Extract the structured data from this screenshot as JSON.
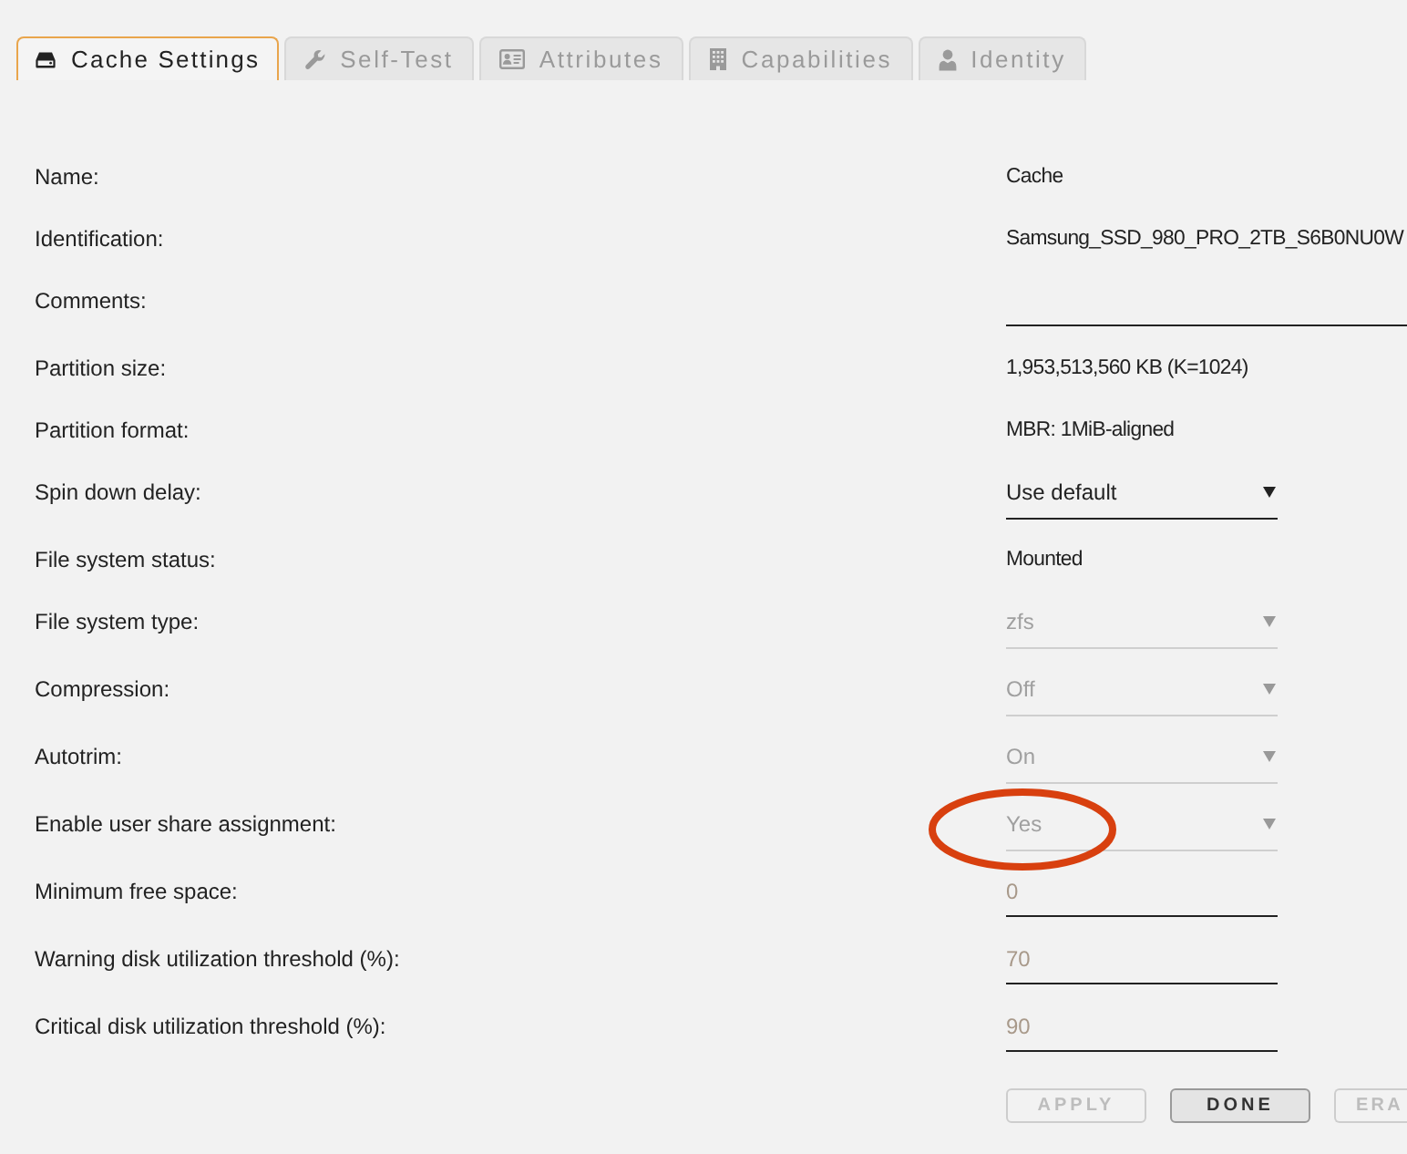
{
  "tabs": [
    {
      "label": "Cache Settings",
      "selected": true
    },
    {
      "label": "Self-Test",
      "selected": false
    },
    {
      "label": "Attributes",
      "selected": false
    },
    {
      "label": "Capabilities",
      "selected": false
    },
    {
      "label": "Identity",
      "selected": false
    }
  ],
  "form": {
    "rows": [
      {
        "label": "Name:",
        "kind": "text",
        "value": "Cache",
        "disabled": false,
        "circled": false
      },
      {
        "label": "Identification:",
        "kind": "text",
        "value": "Samsung_SSD_980_PRO_2TB_S6B0NU0W",
        "disabled": false,
        "circled": false
      },
      {
        "label": "Comments:",
        "kind": "text_input",
        "disabled": false,
        "circled": false
      },
      {
        "label": "Partition size:",
        "kind": "text",
        "value": "1,953,513,560 KB (K=1024)",
        "disabled": false,
        "circled": false
      },
      {
        "label": "Partition format:",
        "kind": "text",
        "value": "MBR: 1MiB-aligned",
        "disabled": false,
        "circled": false
      },
      {
        "label": "Spin down delay:",
        "kind": "select",
        "value": "Use default",
        "disabled": false,
        "circled": false
      },
      {
        "label": "File system status:",
        "kind": "text",
        "value": "Mounted",
        "disabled": false,
        "circled": false
      },
      {
        "label": "File system type:",
        "kind": "select",
        "value": "zfs",
        "disabled": true,
        "circled": false
      },
      {
        "label": "Compression:",
        "kind": "select",
        "value": "Off",
        "disabled": true,
        "circled": false
      },
      {
        "label": "Autotrim:",
        "kind": "select",
        "value": "On",
        "disabled": true,
        "circled": false
      },
      {
        "label": "Enable user share assignment:",
        "kind": "select",
        "value": "Yes",
        "disabled": true,
        "circled": true
      },
      {
        "label": "Minimum free space:",
        "kind": "number_input",
        "placeholder": "0",
        "disabled": false,
        "circled": false
      },
      {
        "label": "Warning disk utilization threshold (%):",
        "kind": "number_input",
        "placeholder": "70",
        "disabled": false,
        "circled": false
      },
      {
        "label": "Critical disk utilization threshold (%):",
        "kind": "number_input",
        "placeholder": "90",
        "disabled": false,
        "circled": false
      }
    ]
  },
  "buttons": [
    {
      "label": "APPLY",
      "disabled": true
    },
    {
      "label": "DONE",
      "disabled": false
    },
    {
      "label": "ERA",
      "disabled": true
    }
  ]
}
